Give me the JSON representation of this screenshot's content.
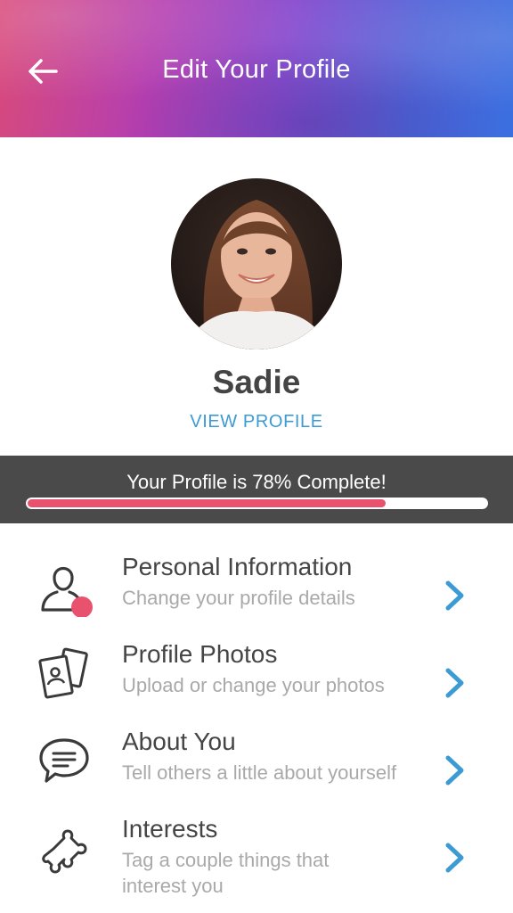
{
  "header": {
    "title": "Edit Your Profile",
    "back_icon": "arrow-left-icon"
  },
  "profile": {
    "name": "Sadie",
    "view_profile_label": "VIEW PROFILE"
  },
  "progress": {
    "text": "Your Profile is 78% Complete!",
    "percent": 78,
    "fill_color": "#e8526e"
  },
  "menu": {
    "items": [
      {
        "title": "Personal Information",
        "subtitle": "Change your profile details",
        "icon": "person-icon"
      },
      {
        "title": "Profile Photos",
        "subtitle": "Upload or change your photos",
        "icon": "photos-icon"
      },
      {
        "title": "About You",
        "subtitle": "Tell others a little about yourself",
        "icon": "chat-bubble-icon"
      },
      {
        "title": "Interests",
        "subtitle": "Tag a couple things that interest you",
        "icon": "puzzle-icon"
      }
    ]
  },
  "colors": {
    "accent": "#3d9bd4",
    "alert_dot": "#e8526e",
    "progress_band": "#4a4a4a"
  }
}
